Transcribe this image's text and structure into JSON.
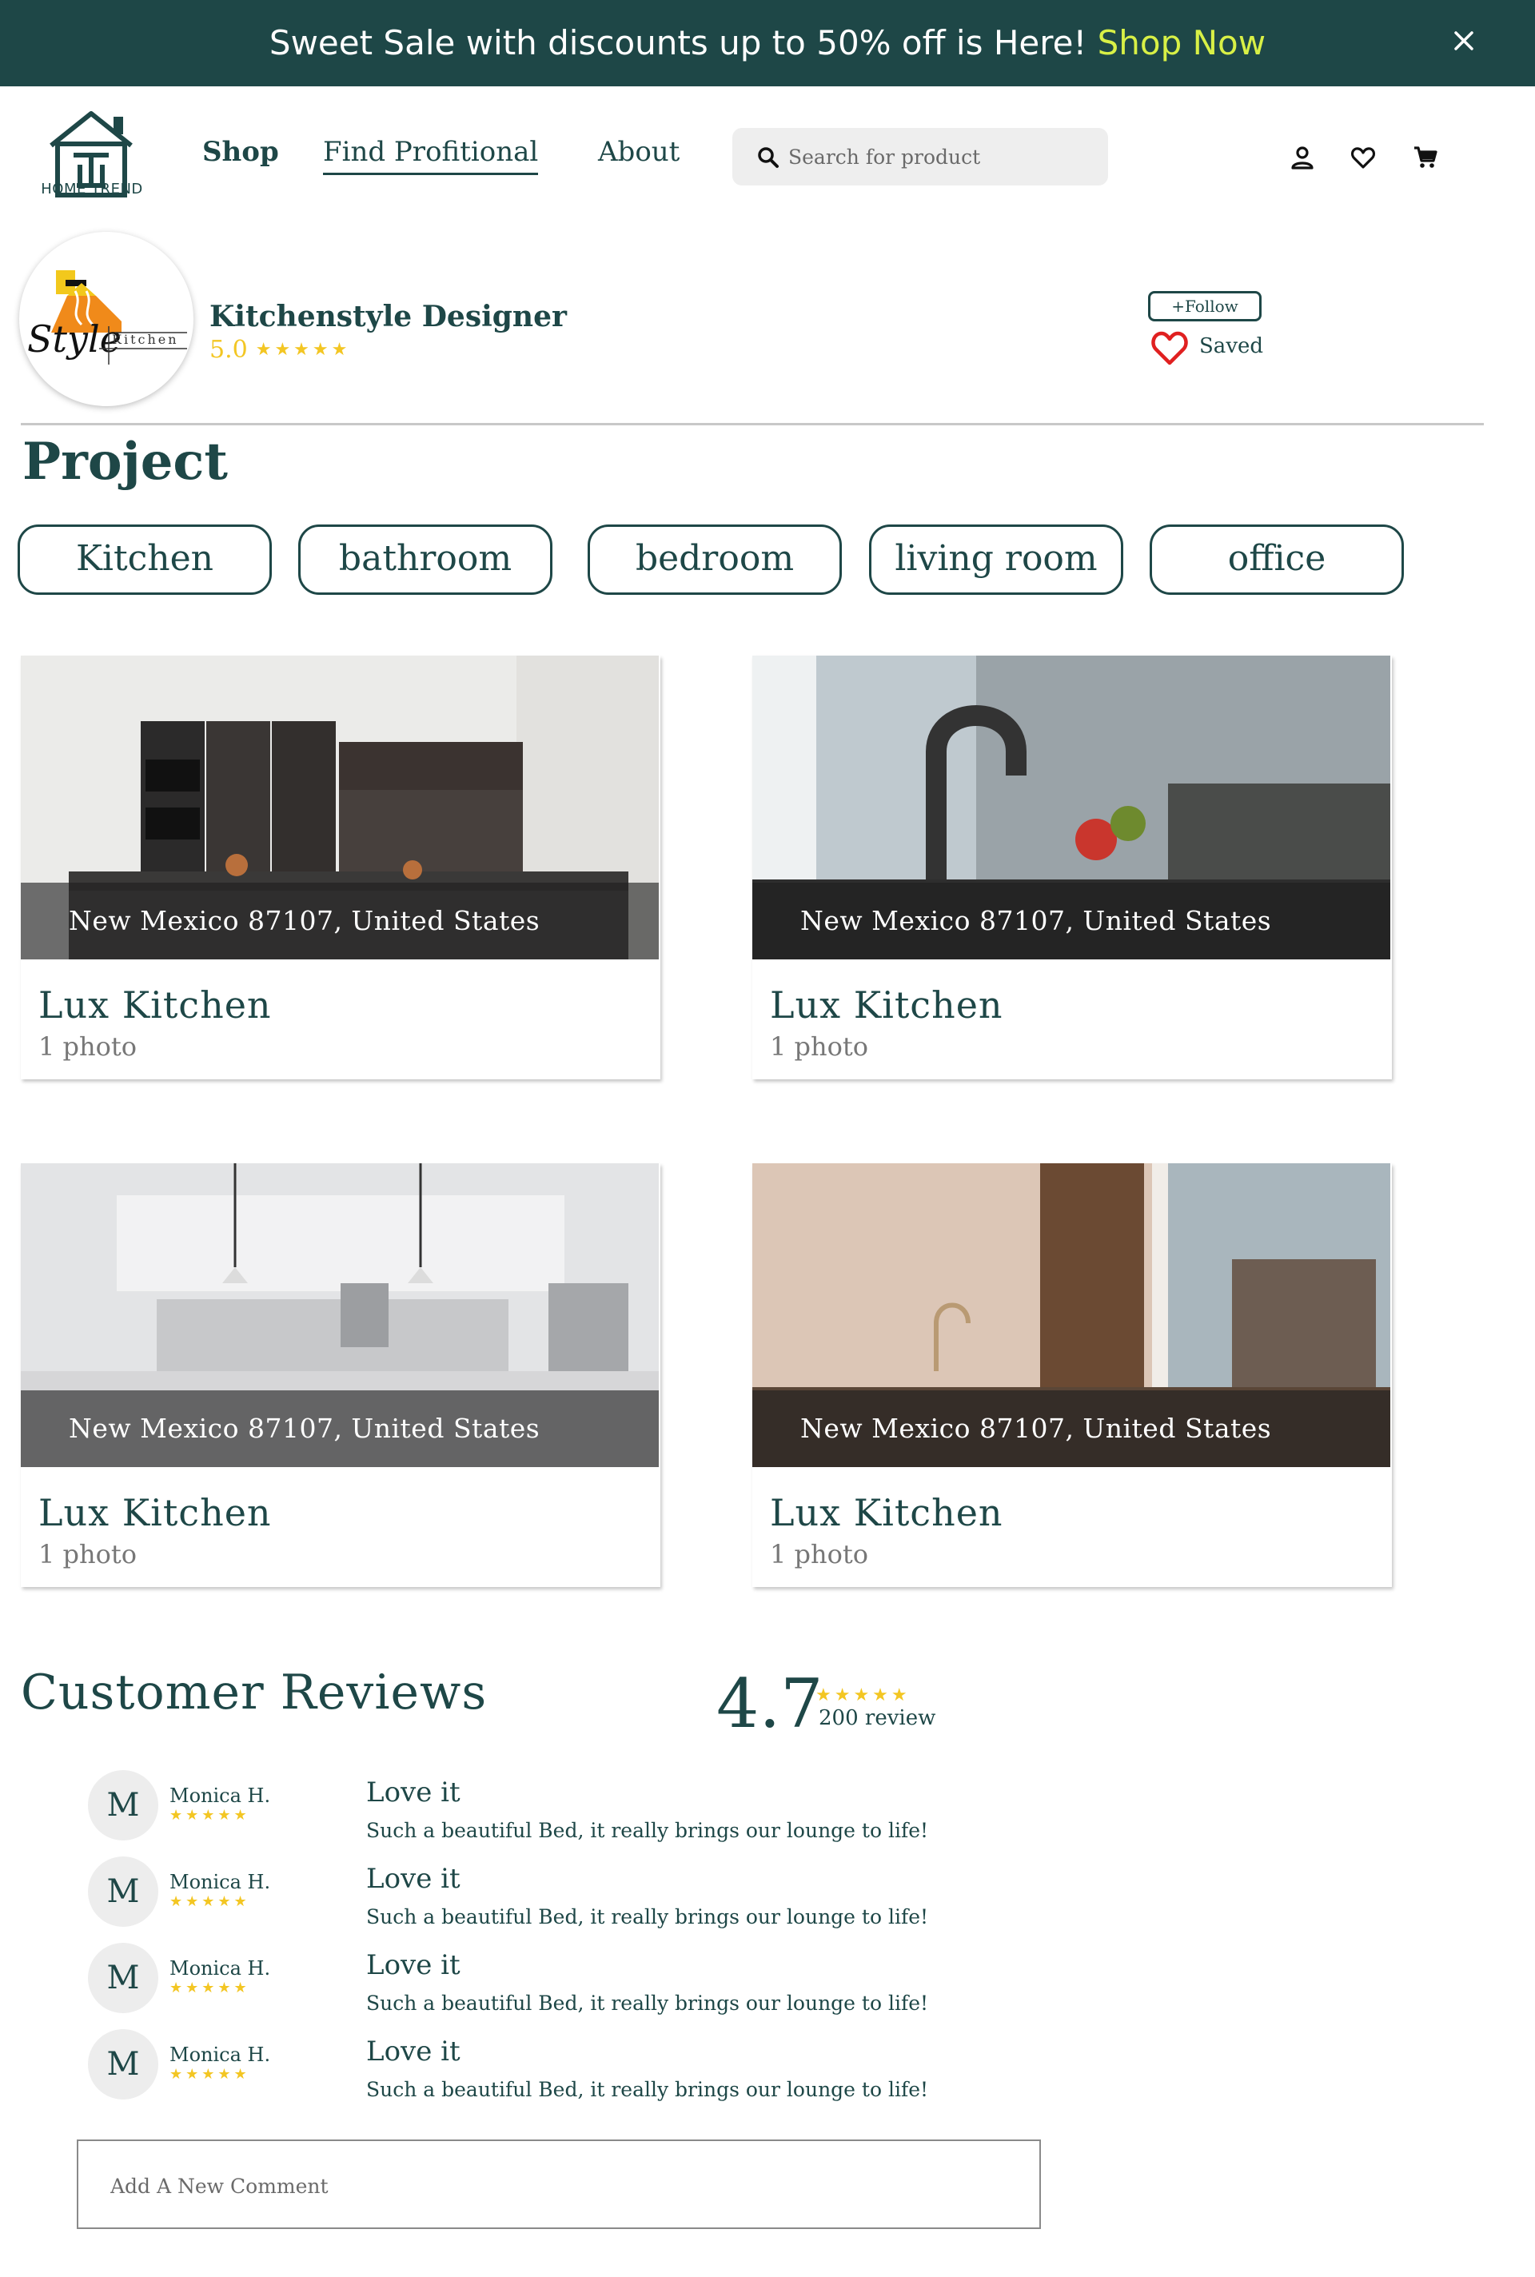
{
  "promo": {
    "text": "Sweet Sale with discounts up to 50% off is Here! ",
    "link": "Shop Now",
    "close_icon": "close-icon"
  },
  "header": {
    "logo_text": "HOME TREND",
    "nav": {
      "shop": "Shop",
      "find": "Find Profitional",
      "about": "About"
    },
    "search_placeholder": "Search for product",
    "icons": [
      "user-icon",
      "heart-icon",
      "cart-icon"
    ]
  },
  "profile": {
    "name": "Kitchenstyle Designer",
    "rating": "5.0",
    "stars": "★★★★★",
    "follow_label": "+Follow",
    "saved_label": "Saved"
  },
  "project": {
    "title": "Project",
    "filters": [
      "Kitchen",
      "bathroom",
      "bedroom",
      "living room",
      "office"
    ]
  },
  "cards": [
    {
      "location": "New Mexico 87107, United States",
      "title": "Lux Kitchen",
      "photos": "1 photo"
    },
    {
      "location": "New Mexico 87107, United States",
      "title": "Lux Kitchen",
      "photos": "1 photo"
    },
    {
      "location": "New Mexico 87107, United States",
      "title": "Lux Kitchen",
      "photos": "1 photo"
    },
    {
      "location": "New Mexico 87107, United States",
      "title": "Lux Kitchen",
      "photos": "1 photo"
    }
  ],
  "reviews": {
    "title": "Customer Reviews",
    "score": "4.7",
    "score_stars": "★★★★★",
    "count": "200 review",
    "items": [
      {
        "initial": "M",
        "name": "Monica H.",
        "stars": "★★★★★",
        "title": "Love it",
        "text": "Such a beautiful Bed, it really brings our lounge to life!"
      },
      {
        "initial": "M",
        "name": "Monica H.",
        "stars": "★★★★★",
        "title": "Love it",
        "text": "Such a beautiful Bed, it really brings our lounge to life!"
      },
      {
        "initial": "M",
        "name": "Monica H.",
        "stars": "★★★★★",
        "title": "Love it",
        "text": "Such a beautiful Bed, it really brings our lounge to life!"
      },
      {
        "initial": "M",
        "name": "Monica H.",
        "stars": "★★★★★",
        "title": "Love it",
        "text": "Such a beautiful Bed, it really brings our lounge to life!"
      }
    ],
    "comment_placeholder": "Add A New Comment"
  },
  "colors": {
    "primary": "#1e4747",
    "accent": "#d8f046",
    "star": "#f3c623",
    "heart": "#e02020"
  }
}
